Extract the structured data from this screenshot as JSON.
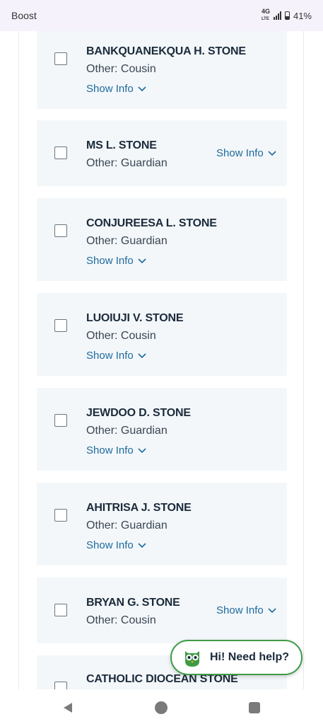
{
  "status_bar": {
    "carrier": "Boost",
    "network": "4G",
    "network_sub": "LTE",
    "battery": "41%"
  },
  "contacts": [
    {
      "name": "BANKQUANEKQUA H. STONE",
      "relation": "Other: Cousin",
      "show_info": "Show Info"
    },
    {
      "name": "MS L. STONE",
      "relation": "Other: Guardian",
      "show_info": "Show Info"
    },
    {
      "name": "CONJUREESA L. STONE",
      "relation": "Other: Guardian",
      "show_info": "Show Info"
    },
    {
      "name": "LUOIUJI V. STONE",
      "relation": "Other: Cousin",
      "show_info": "Show Info"
    },
    {
      "name": "JEWDOO D. STONE",
      "relation": "Other: Guardian",
      "show_info": "Show Info"
    },
    {
      "name": "AHITRISA J. STONE",
      "relation": "Other: Guardian",
      "show_info": "Show Info"
    },
    {
      "name": "BRYAN G. STONE",
      "relation": "Other: Cousin",
      "show_info": "Show Info"
    },
    {
      "name": "CATHOLIC DIOCEAN STONE",
      "relation": "",
      "show_info": ""
    }
  ],
  "help": {
    "label": "Hi! Need help?",
    "accent": "#3f9b45"
  },
  "colors": {
    "link": "#1e6a9c",
    "card_bg": "#f3f7fa"
  }
}
